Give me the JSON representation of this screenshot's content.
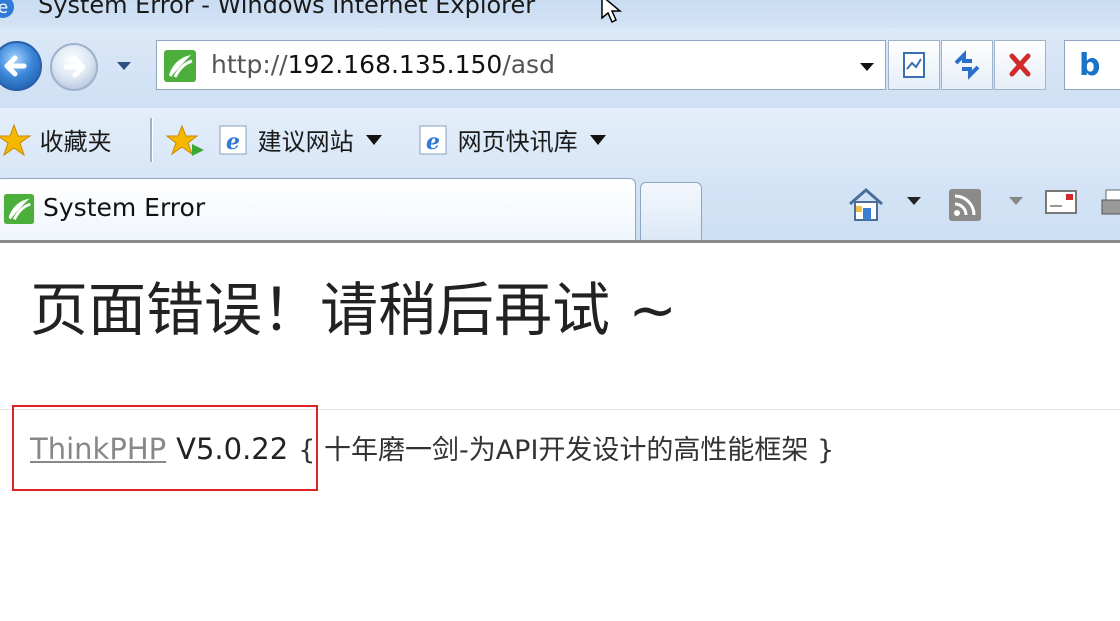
{
  "window": {
    "title": "System Error - Windows Internet Explorer"
  },
  "address_bar": {
    "url_scheme": "http://",
    "url_host": "192.168.135.150",
    "url_path": "/asd"
  },
  "favorites_bar": {
    "favorites_label": "收藏夹",
    "items": [
      {
        "label": "建议网站"
      },
      {
        "label": "网页快讯库"
      }
    ]
  },
  "tabs": [
    {
      "label": "System Error",
      "active": true
    }
  ],
  "page": {
    "heading": "页面错误！请稍后再试 ~",
    "framework_link": "ThinkPHP",
    "version": "V5.0.22",
    "slogan": "{ 十年磨一剑-为API开发设计的高性能框架 }"
  },
  "colors": {
    "highlight_box": "#e02424",
    "link": "#888888",
    "chrome_bg": "#cfe0f4"
  },
  "icons": [
    "ie-logo-icon",
    "cursor-icon",
    "back-icon",
    "forward-icon",
    "site-favicon-icon",
    "compat-view-icon",
    "refresh-icon",
    "stop-icon",
    "bing-icon",
    "star-icon",
    "add-favorite-icon",
    "ie-page-icon",
    "home-icon",
    "rss-icon",
    "mail-icon",
    "print-icon"
  ]
}
